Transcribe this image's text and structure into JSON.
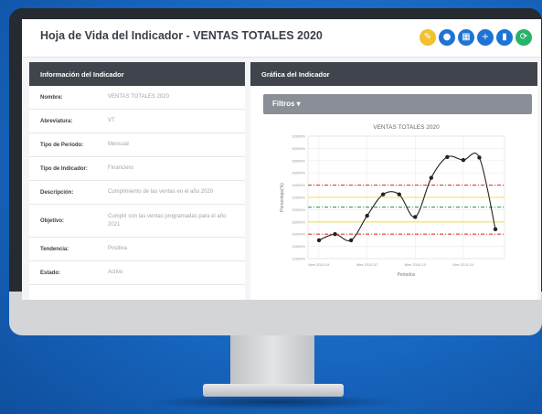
{
  "app": {
    "title": "Hoja de Vida del Indicador - VENTAS TOTALES 2020"
  },
  "header_buttons": [
    {
      "name": "edit-icon",
      "glyph": "✎",
      "color": "#f2c12e"
    },
    {
      "name": "user-icon",
      "glyph": "●",
      "color": "#1e74d4"
    },
    {
      "name": "table-icon",
      "glyph": "▦",
      "color": "#1e74d4"
    },
    {
      "name": "plus-icon",
      "glyph": "+",
      "color": "#1e74d4"
    },
    {
      "name": "bookmark-icon",
      "glyph": "▮",
      "color": "#1e74d4"
    },
    {
      "name": "refresh-icon",
      "glyph": "⟳",
      "color": "#26b36a"
    }
  ],
  "info_panel": {
    "title": "Información del Indicador",
    "rows": [
      {
        "label": "Nombre:",
        "value": "VENTAS TOTALES 2020"
      },
      {
        "label": "Abreviatura:",
        "value": "VT"
      },
      {
        "label": "Tipo de Periodo:",
        "value": "Mensual"
      },
      {
        "label": "Tipo de Indicador:",
        "value": "Financiero"
      },
      {
        "label": "Descripción:",
        "value": "Cumplimiento de las ventas en el año 2020"
      },
      {
        "label": "Objetivo:",
        "value": "Cumplir con las ventas programadas para el año 2021"
      },
      {
        "label": "Tendencia:",
        "value": "Positiva"
      },
      {
        "label": "Estado:",
        "value": "Activo"
      }
    ]
  },
  "chart_panel": {
    "title": "Gráfica del Indicador",
    "filters_label": "Filtros ▾"
  },
  "chart_data": {
    "type": "line",
    "title": "VENTAS TOTALES 2020",
    "xlabel": "Periodos",
    "ylabel": "Porcentaje(%)",
    "x_ticks": [
      "Mes 2020-04",
      "Mes 2020-07",
      "Mes 2020-10",
      "Mes 2021-01"
    ],
    "y_ticks": [
      "12000%",
      "14000%",
      "16000%",
      "18000%",
      "20000%",
      "22000%",
      "24000%",
      "26000%",
      "28000%",
      "30000%",
      "32000%"
    ],
    "ylim": [
      12000,
      32000
    ],
    "x": [
      0,
      1,
      2,
      3,
      4,
      5,
      6,
      7,
      8,
      9,
      10,
      11
    ],
    "values": [
      15000,
      16000,
      15000,
      19000,
      22500,
      22500,
      18800,
      25200,
      28600,
      28100,
      28500,
      16800
    ],
    "thresholds": [
      {
        "value": 24000,
        "color": "#e53935",
        "style": "dashed"
      },
      {
        "value": 22000,
        "color": "#f5e04a",
        "style": "solid"
      },
      {
        "value": 20400,
        "color": "#2e9e4f",
        "style": "dashed"
      },
      {
        "value": 18000,
        "color": "#f5e04a",
        "style": "solid"
      },
      {
        "value": 16000,
        "color": "#e53935",
        "style": "dashed"
      }
    ],
    "grid": true
  }
}
